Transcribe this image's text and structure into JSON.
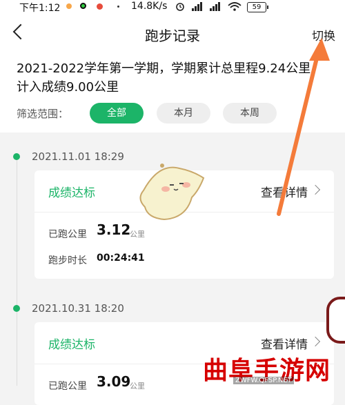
{
  "status_bar": {
    "time": "下午1:12",
    "speed": "14.8K/s",
    "battery": "59",
    "dot_colors": [
      "#f7a74a",
      "#2ecc40",
      "#e74c3c"
    ]
  },
  "nav": {
    "title": "跑步记录",
    "switch_label": "切换"
  },
  "summary": {
    "text": "2021-2022学年第一学期，学期累计总里程9.24公里，计入成绩9.00公里"
  },
  "filter": {
    "label": "筛选范围：",
    "options": [
      "全部",
      "本月",
      "本周"
    ],
    "selected": "全部"
  },
  "records": [
    {
      "datetime": "2021.11.01 18:29",
      "status": "成绩达标",
      "detail_label": "查看详情",
      "distance_label": "已跑公里",
      "distance": "3.12",
      "distance_unit": "公里",
      "duration_label": "跑步时长",
      "duration": "00:24:41"
    },
    {
      "datetime": "2021.10.31 18:20",
      "status": "成绩达标",
      "detail_label": "查看详情",
      "distance_label": "已跑公里",
      "distance": "3.09",
      "distance_unit": "公里"
    }
  ],
  "watermark": {
    "text": "曲阜手游网",
    "url": "ZWFW.QFSP.NET"
  },
  "colors": {
    "accent": "#1cb468",
    "arrow": "#f47b3a",
    "watermark": "#d60000"
  }
}
